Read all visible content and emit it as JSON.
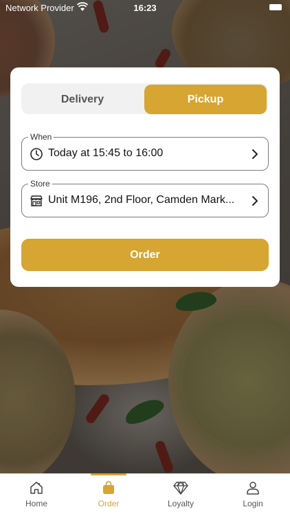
{
  "status_bar": {
    "carrier": "Network Provider",
    "time": "16:23"
  },
  "order_card": {
    "mode_options": [
      "Delivery",
      "Pickup"
    ],
    "selected_mode": "Pickup",
    "when": {
      "label": "When",
      "value": "Today at 15:45 to 16:00",
      "icon": "clock-icon"
    },
    "store": {
      "label": "Store",
      "value": "Unit M196, 2nd Floor, Camden Mark...",
      "icon": "store-icon"
    },
    "order_button": "Order"
  },
  "tab_bar": {
    "items": [
      {
        "label": "Home",
        "icon": "home-icon"
      },
      {
        "label": "Order",
        "icon": "bag-icon"
      },
      {
        "label": "Loyalty",
        "icon": "diamond-icon"
      },
      {
        "label": "Login",
        "icon": "user-icon"
      }
    ],
    "active": "Order"
  },
  "colors": {
    "accent": "#d6a532",
    "card": "#ffffff",
    "segment_bg": "#f1f1f1"
  }
}
